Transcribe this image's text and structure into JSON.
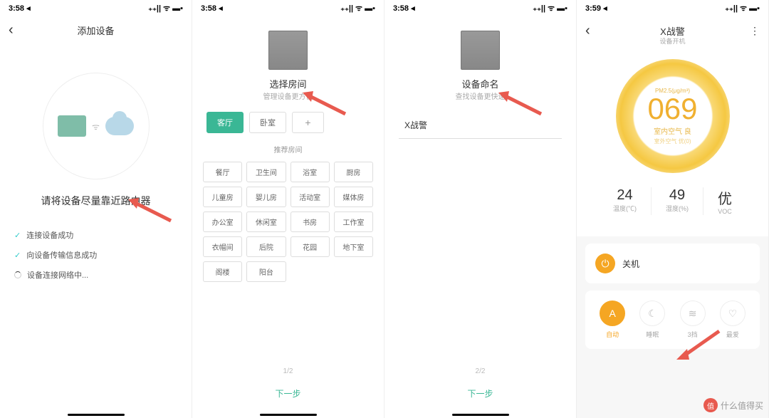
{
  "status": {
    "time1": "3:58 ◂",
    "time2": "3:59 ◂",
    "signal": "⋮⋮",
    "wifi": "ᯤ",
    "battery": "▬▪"
  },
  "s1": {
    "title": "添加设备",
    "instruction": "请将设备尽量靠近路由器",
    "step1": "连接设备成功",
    "step2": "向设备传输信息成功",
    "step3": "设备连接网络中..."
  },
  "s2": {
    "title": "选择房间",
    "subtitle": "管理设备更方便",
    "room_living": "客厅",
    "room_bedroom": "卧室",
    "rec_title": "推荐房间",
    "rec": [
      "餐厅",
      "卫生间",
      "浴室",
      "厨房",
      "儿童房",
      "婴儿房",
      "活动室",
      "媒体房",
      "办公室",
      "休闲室",
      "书房",
      "工作室",
      "衣帽间",
      "后院",
      "花园",
      "地下室",
      "阁楼",
      "阳台"
    ],
    "pager": "1/2",
    "next": "下一步"
  },
  "s3": {
    "title": "设备命名",
    "subtitle": "查找设备更快速",
    "name_value": "X战警",
    "pager": "2/2",
    "next": "下一步"
  },
  "s4": {
    "title": "X战警",
    "subtitle": "设备开机",
    "pm_label": "PM2.5(μg/m³)",
    "pm_value": "069",
    "air_quality": "室内空气 良",
    "outdoor": "室外空气 优(0)",
    "temp_val": "24",
    "temp_lbl": "温度(℃)",
    "hum_val": "49",
    "hum_lbl": "湿度(%)",
    "voc_val": "优",
    "voc_lbl": "VOC",
    "power": "关机",
    "mode_auto": "自动",
    "mode_sleep": "睡眠",
    "mode_3": "3挡",
    "mode_fav": "最爱"
  },
  "wm": "什么值得买"
}
